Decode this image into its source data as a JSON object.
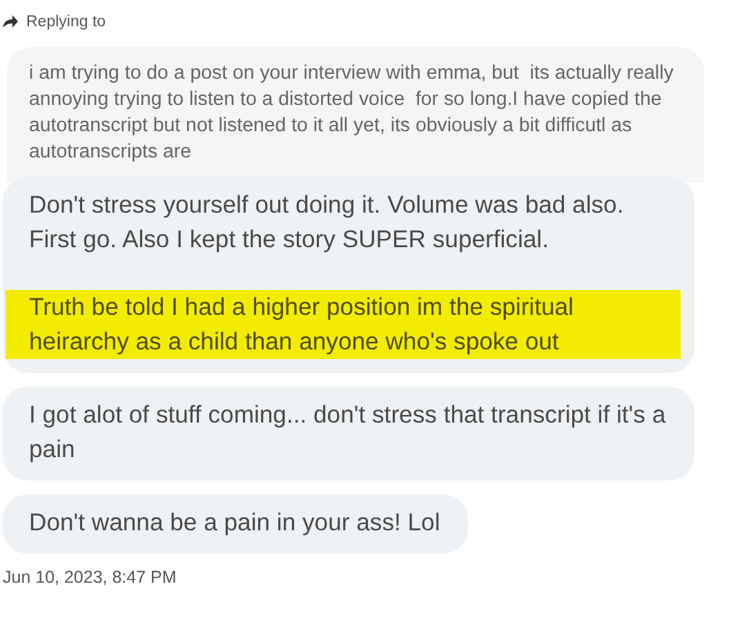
{
  "reply_header": {
    "label": "Replying to"
  },
  "quoted_message": {
    "text": "i am trying to do a post on your interview with emma, but  its actually really annoying trying to listen to a distorted voice  for so long.I have copied the autotranscript but not listened to it all yet, its obviously a bit difficutl as autotranscripts are"
  },
  "messages": [
    {
      "paragraphs": [
        {
          "text": "Don't stress yourself out doing it. Volume was bad also. First go. Also I kept the story SUPER superficial.",
          "highlighted": false
        },
        {
          "text": "Truth be told I had a higher position im the spiritual heirarchy as a child than anyone who's spoke out",
          "highlighted": true
        }
      ]
    },
    {
      "paragraphs": [
        {
          "text": "I got alot of stuff coming... don't stress that transcript if it's a pain",
          "highlighted": false
        }
      ]
    },
    {
      "paragraphs": [
        {
          "text": "Don't wanna be a pain in your ass! Lol",
          "highlighted": false
        }
      ]
    }
  ],
  "timestamp": "Jun 10, 2023, 8:47 PM"
}
